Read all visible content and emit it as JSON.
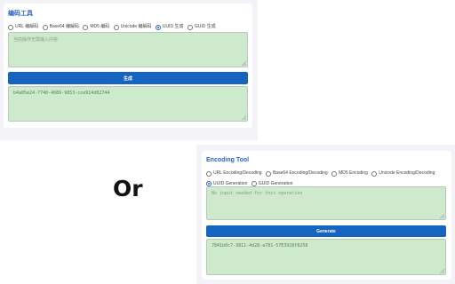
{
  "divider": "Or",
  "colors": {
    "accent": "#2b63c8",
    "button": "#1565c0",
    "textarea_bg": "#cdeacd"
  },
  "panel_zh": {
    "title": "编码工具",
    "options": [
      {
        "label": "URL 编解码",
        "selected": false
      },
      {
        "label": "Base64 编解码",
        "selected": false
      },
      {
        "label": "MD5 编码",
        "selected": false
      },
      {
        "label": "Unicode 编解码",
        "selected": false
      },
      {
        "label": "UUID 生成",
        "selected": true
      },
      {
        "label": "GUID 生成",
        "selected": false
      }
    ],
    "input_placeholder": "当前操作无需输入内容",
    "button_label": "生成",
    "output_value": "b4a05e24-7740-4089-9853-cce914d82744"
  },
  "panel_en": {
    "title": "Encoding Tool",
    "options": [
      {
        "label": "URL Encoding/Decoding",
        "selected": false
      },
      {
        "label": "Base64 Encoding/Decoding",
        "selected": false
      },
      {
        "label": "MD5 Encoding",
        "selected": false
      },
      {
        "label": "Unicode Encoding/Decoding",
        "selected": false
      },
      {
        "label": "UUID Generation",
        "selected": true
      },
      {
        "label": "GUID Generation",
        "selected": false
      }
    ],
    "input_placeholder": "No input needed for this operation",
    "button_label": "Generate",
    "output_value": "7841b0c7-3811-4d28-a781-57E3928f8258"
  }
}
